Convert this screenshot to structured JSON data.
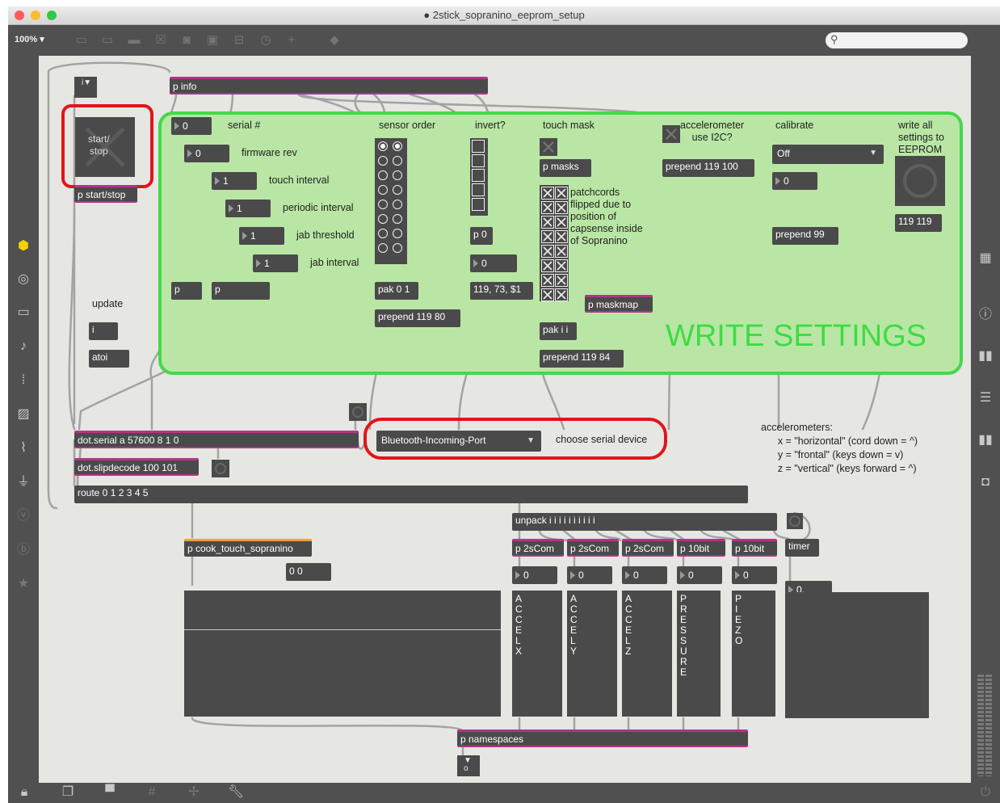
{
  "window": {
    "title": "2stick_sopranino_eeprom_setup"
  },
  "toolbar": {
    "zoom": "100% ▾"
  },
  "patch": {
    "p_info": "p info",
    "start_stop_button": "start/\nstop",
    "p_start_stop": "p start/stop",
    "serial_num_label": "serial #",
    "firmware_rev_label": "firmware rev",
    "touch_interval_label": "touch interval",
    "periodic_interval_label": "periodic interval",
    "jab_threshold_label": "jab threshold",
    "jab_interval_label": "jab interval",
    "serial_num_value": "0",
    "firmware_rev_value": "0",
    "touch_interval_value": "1",
    "periodic_interval_value": "1",
    "jab_threshold_value": "1",
    "jab_interval_value": "1",
    "p_a": "p",
    "p_b": "p",
    "sensor_order_label": "sensor order",
    "pak_0_1": "pak 0 1",
    "prepend_119_80": "prepend 119 80",
    "invert_label": "invert?",
    "p_0": "p 0",
    "invert_num": "0",
    "invert_msg": "119, 73, $1",
    "touch_mask_label": "touch mask",
    "p_masks": "p masks",
    "patchcords_comment": "patchcords\nflipped due to\nposition of\ncapsense inside\nof Sopranino",
    "p_maskmap": "p maskmap",
    "pak_i_i": "pak i i",
    "prepend_119_84": "prepend 119 84",
    "accel_label": "accelerometer\nuse I2C?",
    "prepend_119_100": "prepend 119 100",
    "calibrate_label": "calibrate",
    "calibrate_menu": "Off",
    "calibrate_num": "0",
    "prepend_99": "prepend 99",
    "write_all_label": "write all\nsettings to\nEEPROM",
    "msg_119_119": "119 119",
    "write_settings": "WRITE SETTINGS",
    "update_label": "update",
    "i_obj": "i",
    "atoi": "atoi",
    "dot_serial": "dot.serial a 57600 8 1 0",
    "serial_menu": "Bluetooth-Incoming-Port",
    "choose_serial": "choose serial device",
    "dot_slipdecode": "dot.slipdecode 100 101",
    "route": "route 0 1 2 3 4 5",
    "unpack": "unpack i i i i i i i i i i",
    "p_cook_touch": "p cook_touch_sopranino",
    "msg_00": "0 0",
    "p_2scom_1": "p 2sCom",
    "p_2scom_2": "p 2sCom",
    "p_2scom_3": "p 2sCom",
    "p_10bit_1": "p 10bit",
    "p_10bit_2": "p 10bit",
    "timer": "timer",
    "num_1": "0",
    "num_2": "0",
    "num_3": "0",
    "num_4": "0",
    "num_5": "0",
    "flonum": "0.",
    "accelx": "A\nC\nC\nE\nL\nX",
    "accely": "A\nC\nC\nE\nL\nY",
    "accelz": "A\nC\nC\nE\nL\nZ",
    "pressure": "P\nR\nE\nS\nS\nU\nR\nE",
    "piezo": "P\nI\nE\nZ\nO",
    "p_namespaces": "p namespaces",
    "accel_comment": "accelerometers:\n      x = \"horizontal\" (cord down = ^)\n      y = \"frontal\" (keys down = v)\n      z = \"vertical\" (keys forward = ^)"
  }
}
